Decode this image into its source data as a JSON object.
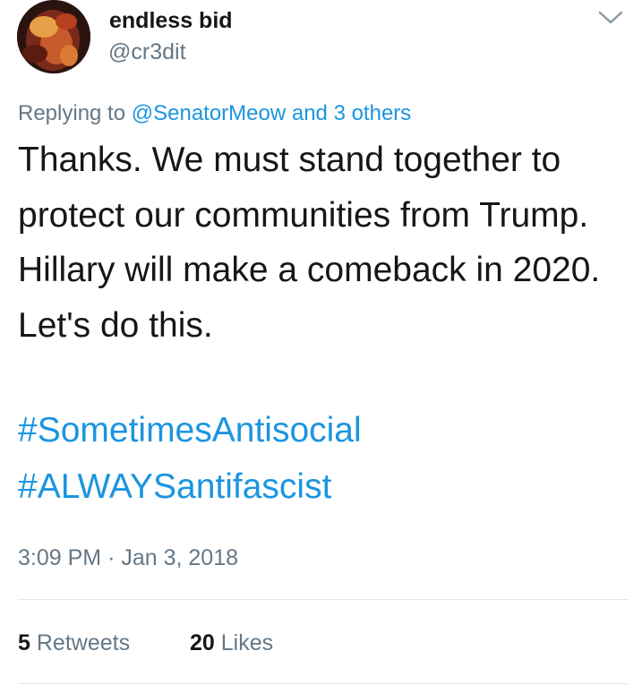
{
  "user": {
    "display_name": "endless bid",
    "handle": "@cr3dit"
  },
  "icons": {
    "avatar": "avatar-photo",
    "menu": "chevron-down-icon"
  },
  "reply": {
    "prefix": "Replying to",
    "mention_text": "@SenatorMeow and 3 others"
  },
  "tweet": {
    "text": "Thanks. We must stand together to protect our communities from Trump. Hillary will make a comeback in 2020. Let's do this.",
    "hashtags": [
      "#SometimesAntisocial",
      "#ALWAYSantifascist"
    ]
  },
  "meta": {
    "time": "3:09 PM",
    "separator": "·",
    "date": "Jan 3, 2018"
  },
  "stats": {
    "retweets_count": "5",
    "retweets_label": "Retweets",
    "likes_count": "20",
    "likes_label": "Likes"
  },
  "colors": {
    "link": "#1b95e0",
    "secondary_text": "#657786",
    "primary_text": "#14171a",
    "divider": "#e1e8ed"
  }
}
